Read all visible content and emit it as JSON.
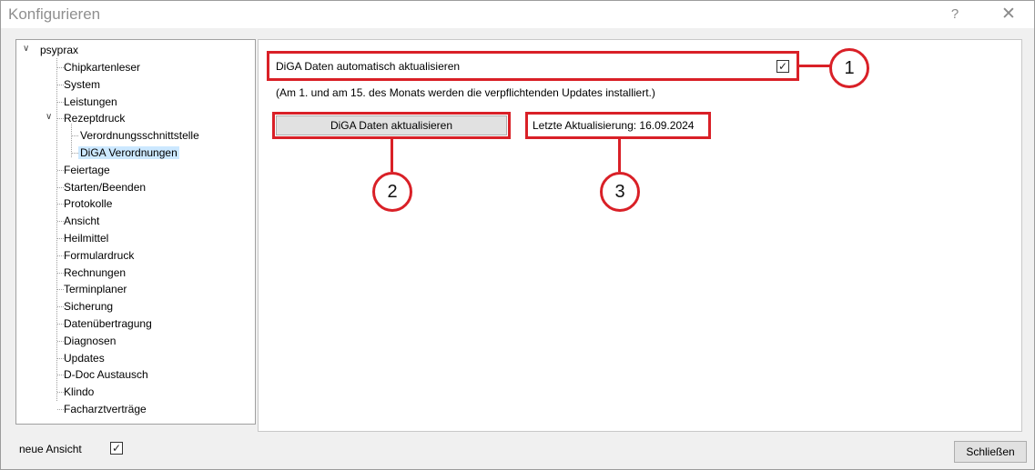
{
  "window": {
    "title": "Konfigurieren",
    "help_glyph": "?",
    "close_glyph": "✕"
  },
  "tree": {
    "root": "psyprax",
    "expander_glyph": "∨",
    "items": [
      {
        "label": "Chipkartenleser"
      },
      {
        "label": "System"
      },
      {
        "label": "Leistungen"
      },
      {
        "label": "Rezeptdruck"
      },
      {
        "label": "Verordnungsschnittstelle"
      },
      {
        "label": "DiGA Verordnungen"
      },
      {
        "label": "Feiertage"
      },
      {
        "label": "Starten/Beenden"
      },
      {
        "label": "Protokolle"
      },
      {
        "label": "Ansicht"
      },
      {
        "label": "Heilmittel"
      },
      {
        "label": "Formulardruck"
      },
      {
        "label": "Rechnungen"
      },
      {
        "label": "Terminplaner"
      },
      {
        "label": "Sicherung"
      },
      {
        "label": "Datenübertragung"
      },
      {
        "label": "Diagnosen"
      },
      {
        "label": "Updates"
      },
      {
        "label": "D-Doc Austausch"
      },
      {
        "label": "Klindo"
      },
      {
        "label": "Facharztverträge"
      }
    ],
    "selected": "DiGA Verordnungen"
  },
  "settings": {
    "auto_update_label": "DiGA Daten automatisch aktualisieren",
    "auto_update_checked": true,
    "check_glyph": "✓",
    "note": "(Am 1. und am 15. des Monats werden die verpflichtenden Updates installiert.)",
    "update_button": "DiGA Daten aktualisieren",
    "last_update": "Letzte Aktualisierung: 16.09.2024"
  },
  "callouts": {
    "one": "1",
    "two": "2",
    "three": "3"
  },
  "footer": {
    "new_view_label": "neue Ansicht",
    "new_view_checked": true,
    "close_button": "Schließen"
  },
  "colors": {
    "highlight": "#d92027",
    "selection": "#cce8ff"
  }
}
